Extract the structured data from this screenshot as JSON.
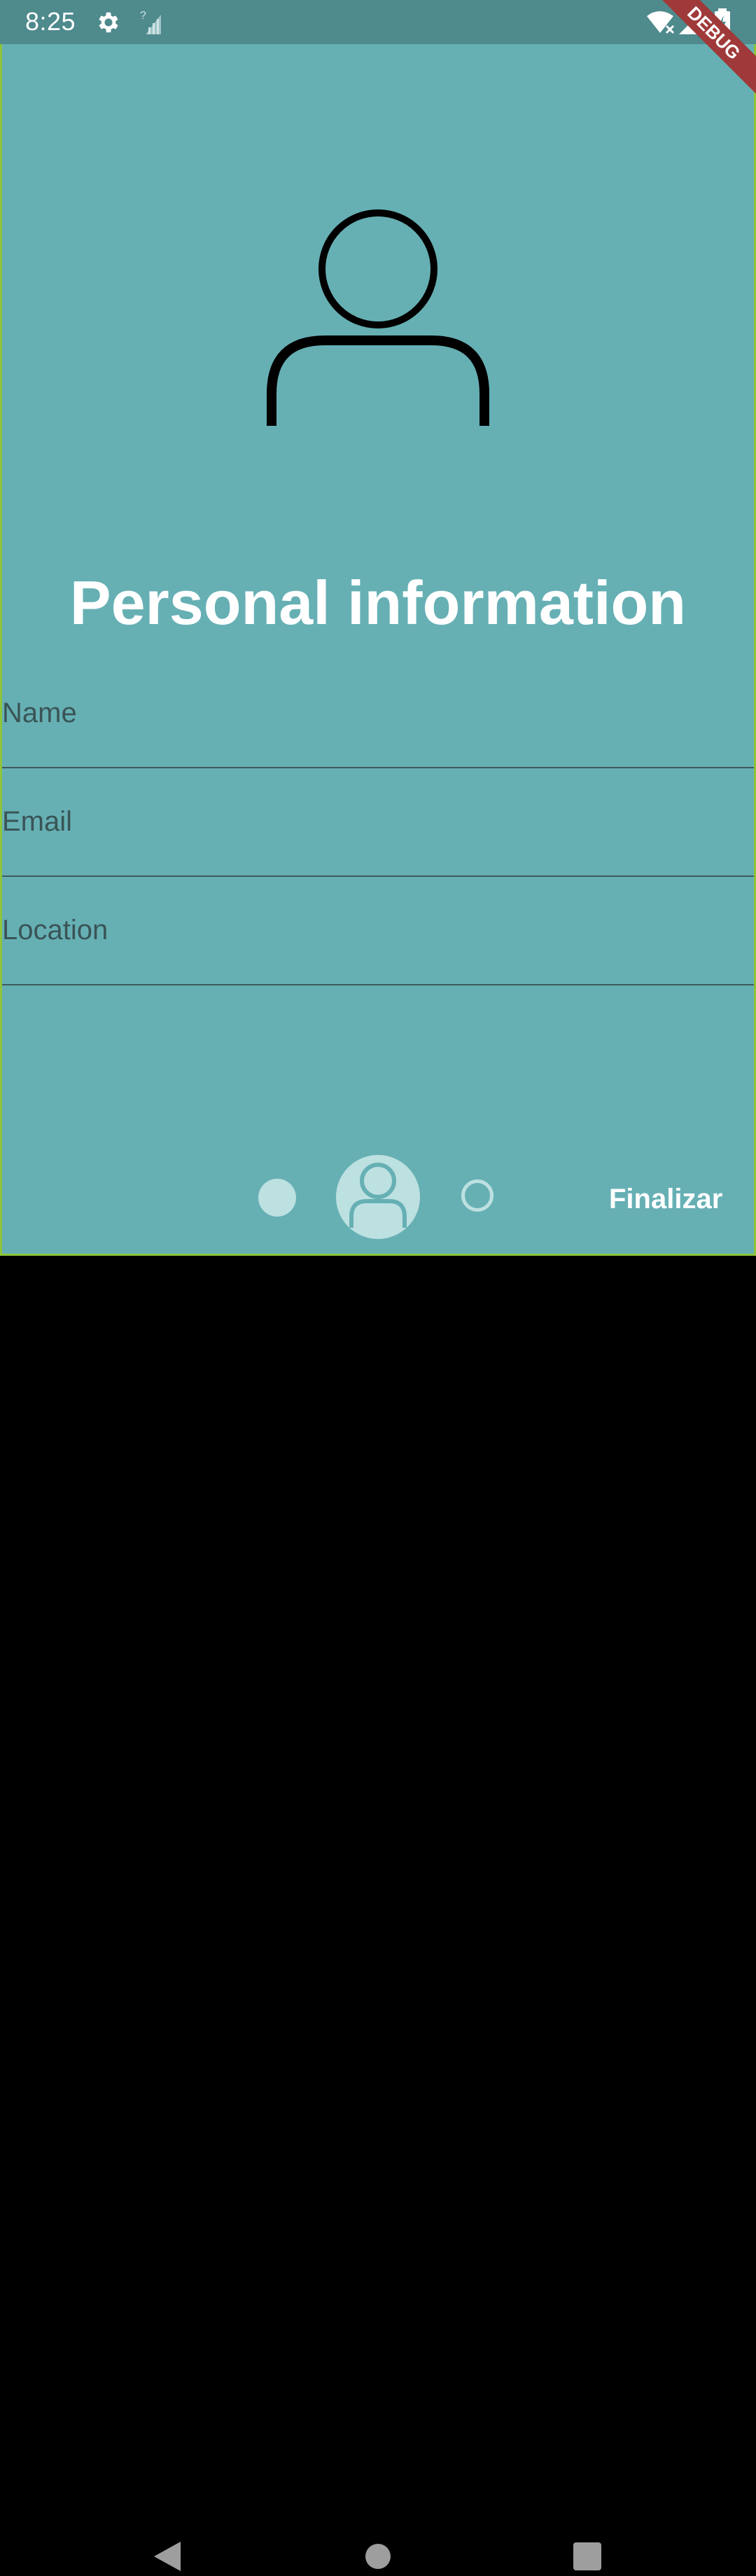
{
  "status_bar": {
    "time": "8:25",
    "icons": [
      "settings-icon",
      "signal-unknown-icon",
      "wifi-off-icon",
      "cell-signal-icon",
      "battery-charging-icon"
    ]
  },
  "debug_banner": "DEBUG",
  "hero_icon": "person-outline-icon",
  "page_title": "Personal information",
  "form": {
    "name_label": "Name",
    "email_label": "Email",
    "location_label": "Location"
  },
  "pager": {
    "current_page": 2,
    "total_pages": 3,
    "current_icon": "person-icon"
  },
  "finish_label": "Finalizar",
  "colors": {
    "background": "#66b0b4",
    "status_bar": "#4f8a8d",
    "indicator": "#bde0e1",
    "accent_border": "#8dc43a"
  }
}
